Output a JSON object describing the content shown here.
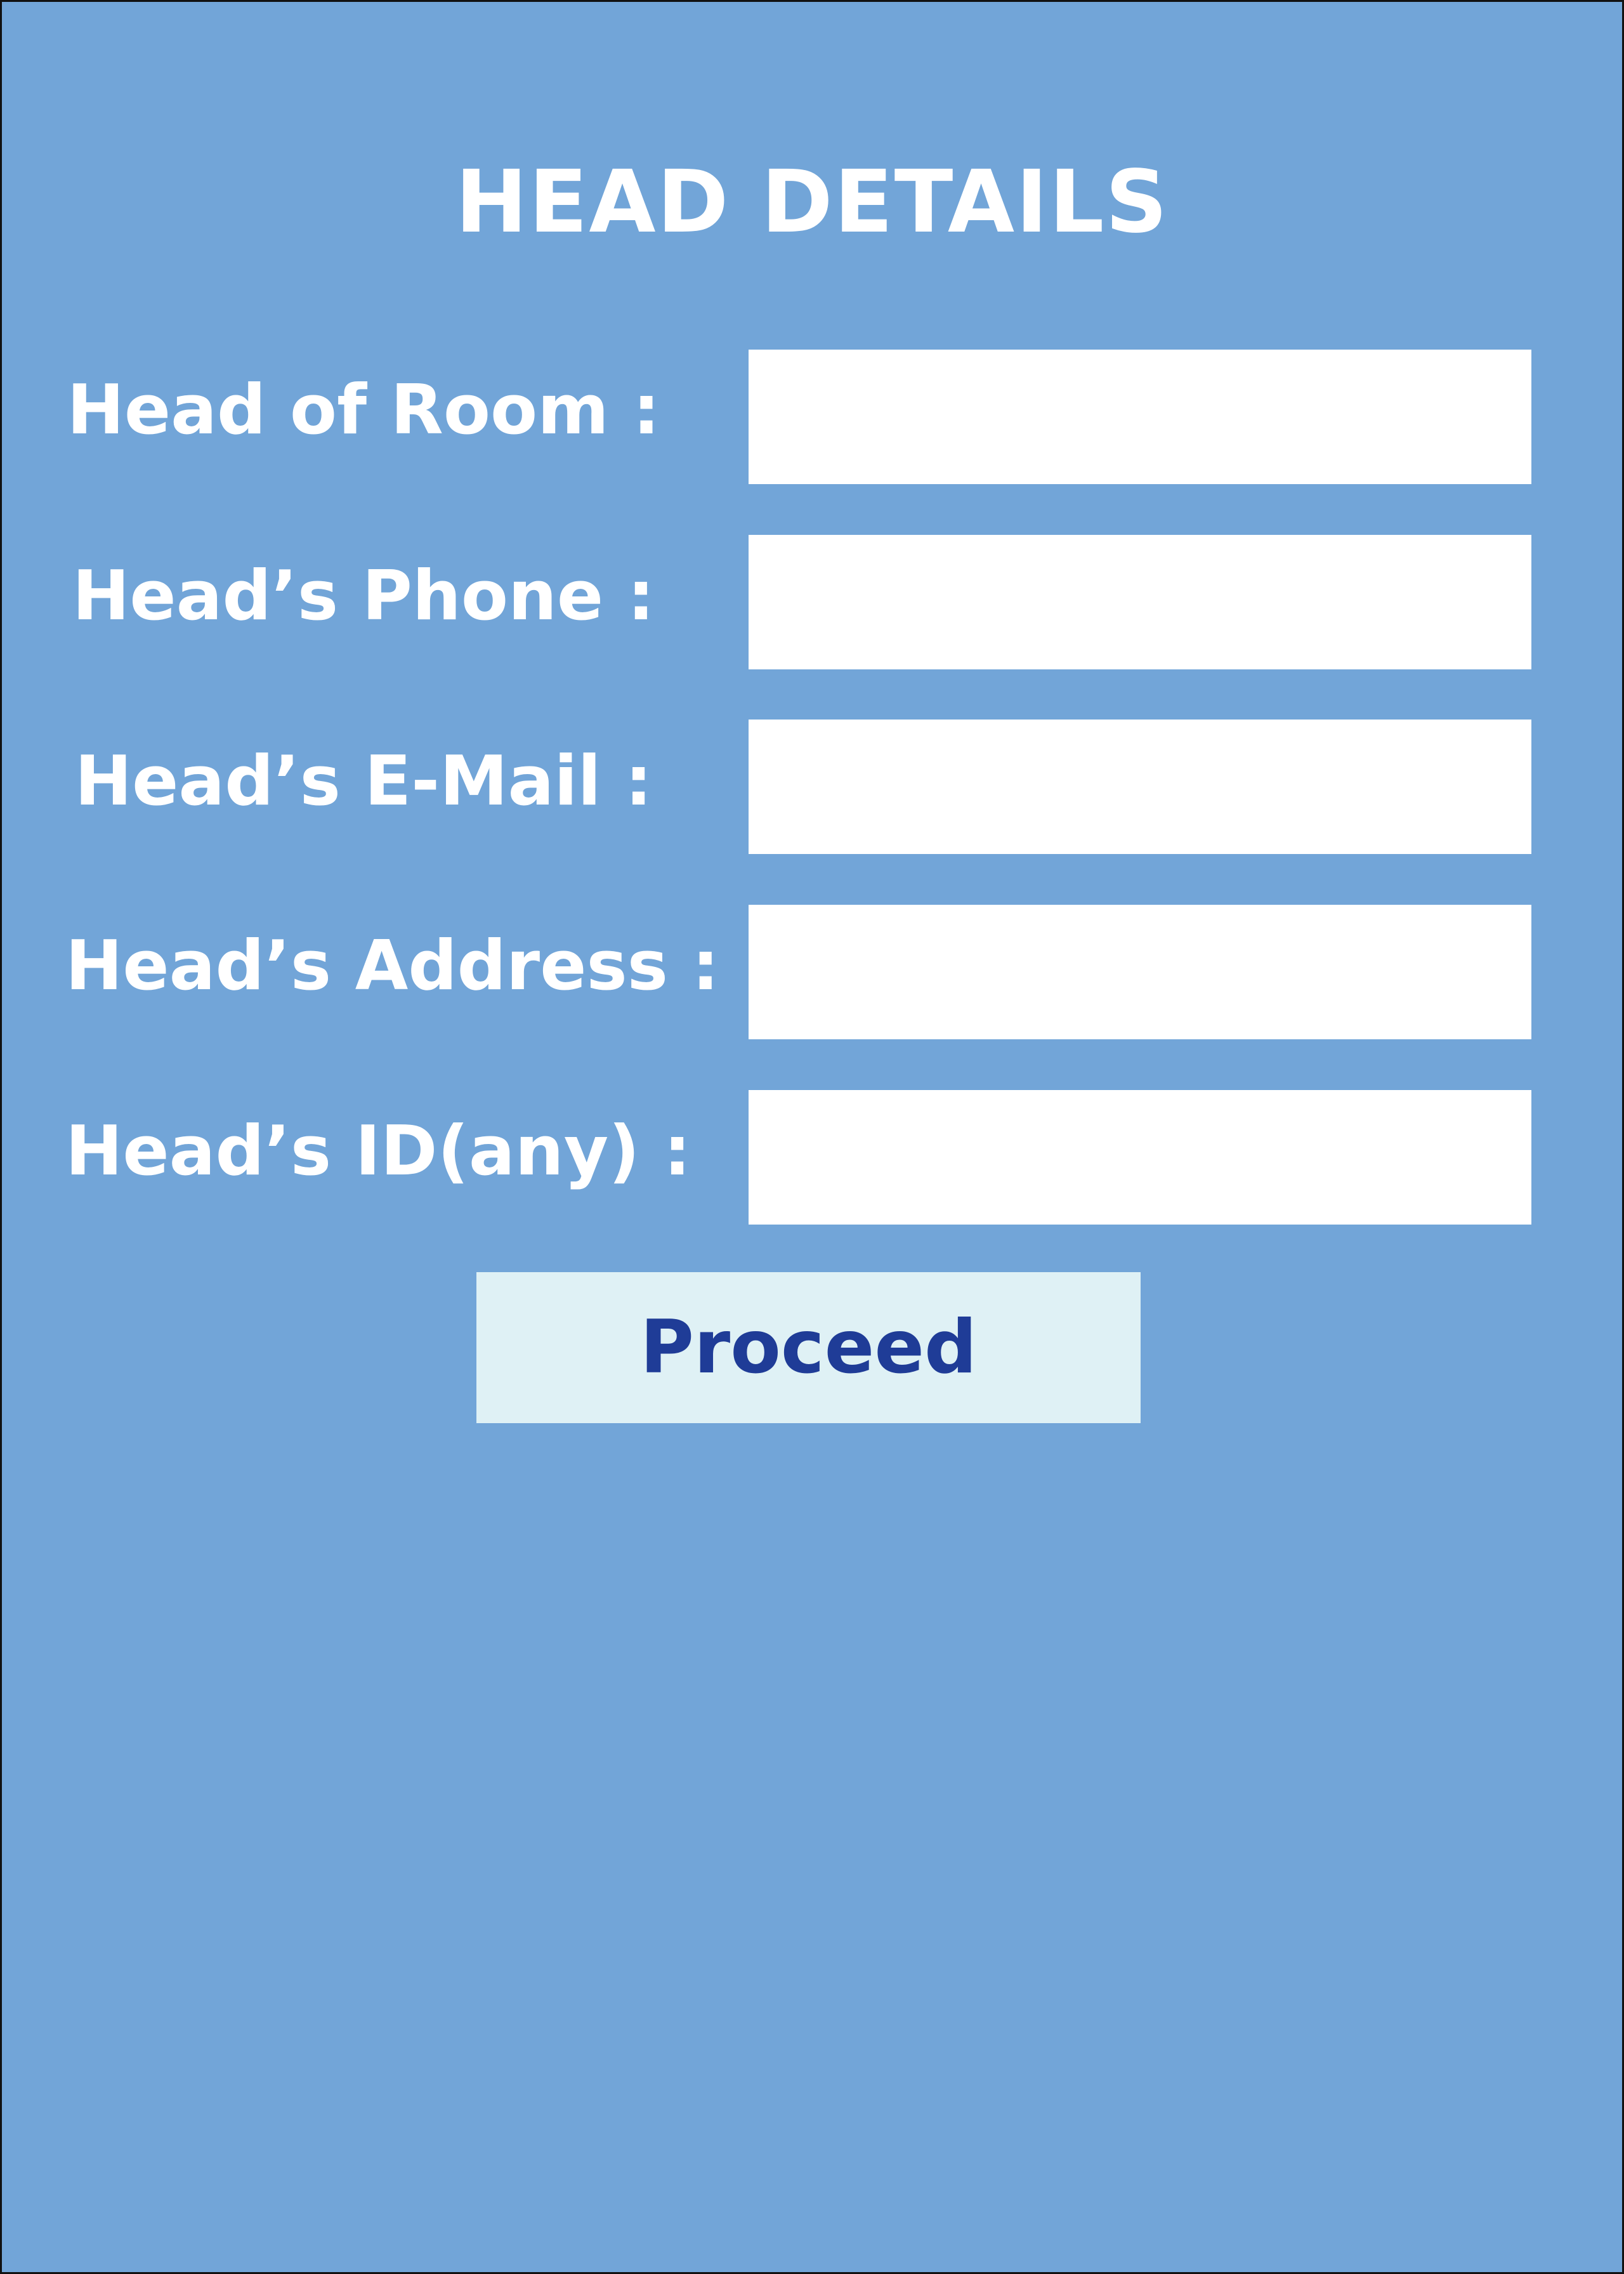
{
  "page": {
    "title": "HEAD DETAILS"
  },
  "form": {
    "fields": [
      {
        "label": "Head of Room :",
        "value": "",
        "placeholder": ""
      },
      {
        "label": "Head’s Phone :",
        "value": "",
        "placeholder": ""
      },
      {
        "label": "Head’s E-Mail :",
        "value": "",
        "placeholder": ""
      },
      {
        "label": "Head’s Address :",
        "value": "",
        "placeholder": ""
      },
      {
        "label": "Head’s ID(any) :",
        "value": "",
        "placeholder": ""
      }
    ],
    "proceed_label": "Proceed"
  },
  "colors": {
    "background": "#72a5d8",
    "field_background": "#ffffff",
    "button_background": "#dff1f5",
    "button_text": "#1f3c97",
    "label_text": "#ffffff",
    "frame_border": "#111111"
  }
}
